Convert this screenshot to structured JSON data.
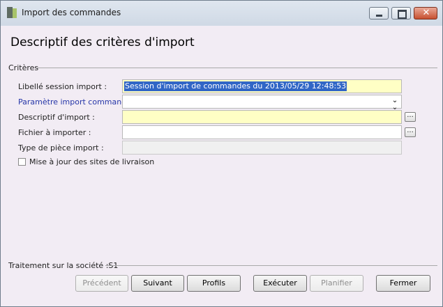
{
  "window": {
    "title": "Import des commandes",
    "minimize_icon": "minimize-icon",
    "maximize_icon": "maximize-icon",
    "close_icon": "close-icon"
  },
  "header": {
    "title": "Descriptif des critères d'import"
  },
  "criteria": {
    "group_label": "Critères",
    "fields": [
      {
        "label": "Libellé session import :",
        "value": "Session d'import de commandes du 2013/05/29 12:48:53"
      },
      {
        "label": "Paramètre import commande :",
        "value": ""
      },
      {
        "label": "Descriptif d'import :",
        "value": "",
        "browse": "..."
      },
      {
        "label": "Fichier à importer :",
        "value": "",
        "browse": "..."
      },
      {
        "label": "Type de pièce import :",
        "value": ""
      }
    ],
    "checkbox": {
      "label": "Mise à jour des sites de livraison",
      "checked": false
    }
  },
  "footer": {
    "label": "Traitement sur la société :S1",
    "buttons": {
      "previous": "Précédent",
      "next": "Suivant",
      "profiles": "Profils",
      "execute": "Exécuter",
      "schedule": "Planifier",
      "close": "Fermer"
    }
  },
  "colors": {
    "required_field": "#ffffc5",
    "link_label": "#2636a8",
    "selection": "#3166c6"
  }
}
